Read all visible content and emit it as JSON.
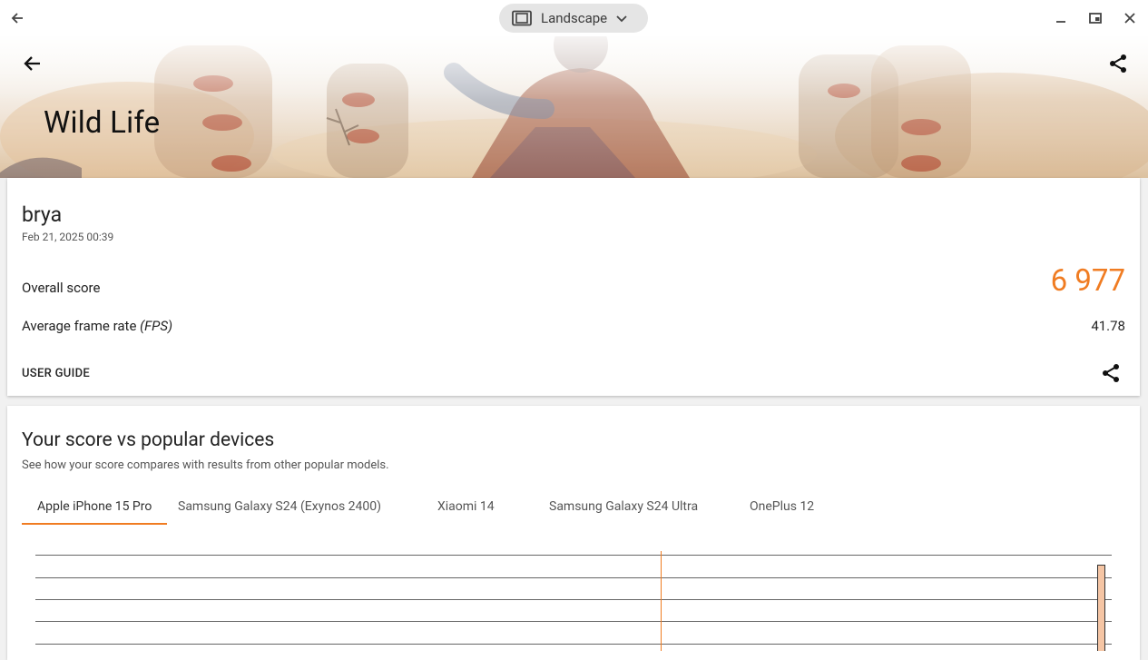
{
  "window": {
    "orientation_label": "Landscape"
  },
  "hero": {
    "title": "Wild Life"
  },
  "result": {
    "user": "brya",
    "date": "Feb 21, 2025 00:39",
    "overall_label": "Overall score",
    "overall_value": "6 977",
    "fps_label": "Average frame rate",
    "fps_unit": "(FPS)",
    "fps_value": "41.78",
    "user_guide_label": "USER GUIDE"
  },
  "compare": {
    "title": "Your score vs popular devices",
    "subtitle": "See how your score compares with results from other popular models.",
    "tabs": [
      {
        "label": "Apple iPhone 15 Pro",
        "active": true
      },
      {
        "label": "Samsung Galaxy S24 (Exynos 2400)",
        "active": false
      },
      {
        "label": "Xiaomi 14",
        "active": false
      },
      {
        "label": "Samsung Galaxy S24 Ultra",
        "active": false
      },
      {
        "label": "OnePlus 12",
        "active": false
      }
    ]
  },
  "colors": {
    "accent": "#f07c22"
  }
}
